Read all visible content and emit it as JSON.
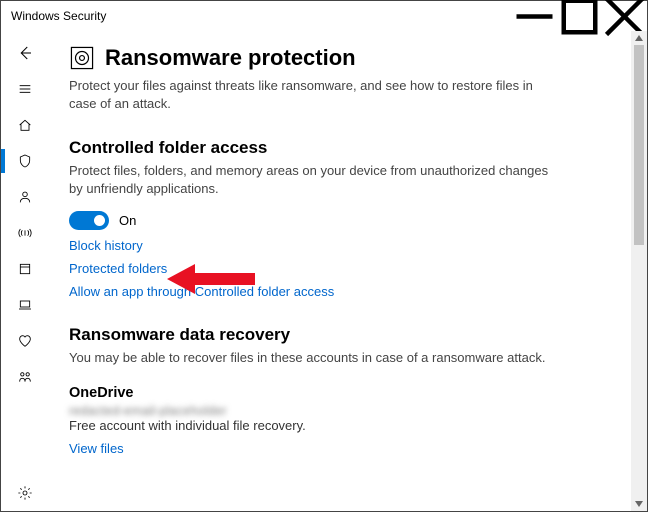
{
  "window": {
    "title": "Windows Security"
  },
  "page": {
    "title": "Ransomware protection",
    "subtitle": "Protect your files against threats like ransomware, and see how to restore files in case of an attack."
  },
  "cfa": {
    "title": "Controlled folder access",
    "subtitle": "Protect files, folders, and memory areas on your device from unauthorized changes by unfriendly applications.",
    "toggle_state": "On",
    "links": {
      "block_history": "Block history",
      "protected_folders": "Protected folders",
      "allow_app": "Allow an app through Controlled folder access"
    }
  },
  "recovery": {
    "title": "Ransomware data recovery",
    "subtitle": "You may be able to recover files in these accounts in case of a ransomware attack.",
    "provider": "OneDrive",
    "email_redacted": "redacted-email-placeholder",
    "desc": "Free account with individual file recovery.",
    "view_files": "View files"
  },
  "nav": {
    "back": "back",
    "menu": "menu",
    "home": "home",
    "shield": "virus-threat-protection",
    "account": "account-protection",
    "firewall": "firewall-network-protection",
    "app": "app-browser-control",
    "device": "device-security",
    "health": "device-performance-health",
    "family": "family-options",
    "settings": "settings"
  }
}
